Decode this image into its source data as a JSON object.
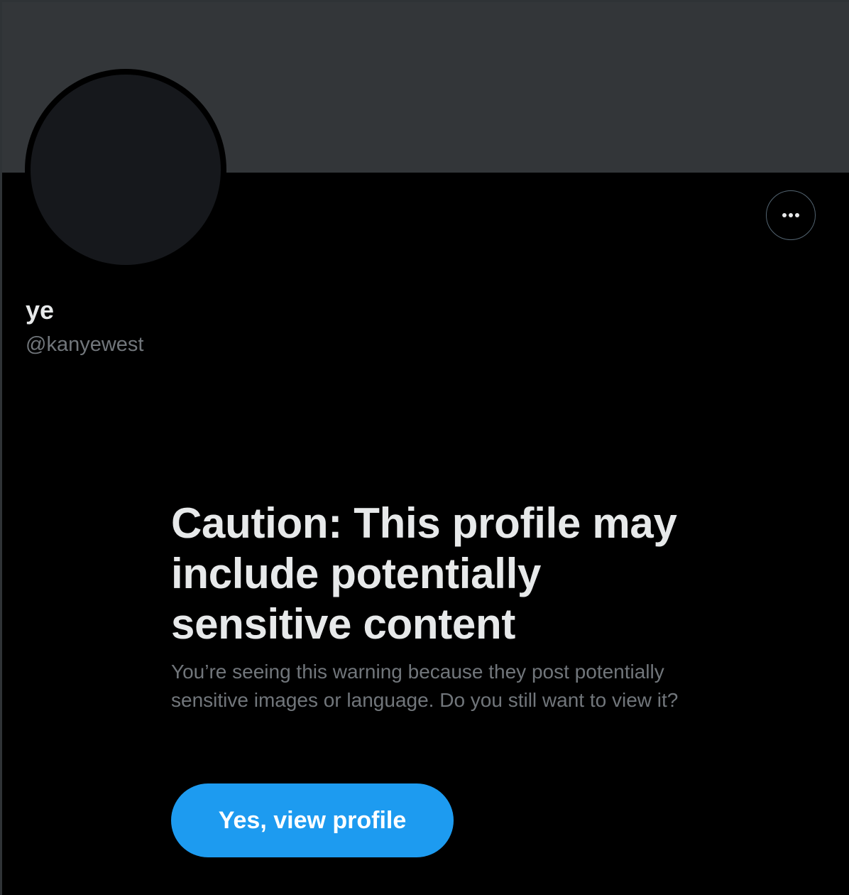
{
  "profile": {
    "display_name": "ye",
    "handle": "@kanyewest"
  },
  "actions": {
    "more_icon": "more-horizontal-icon"
  },
  "warning": {
    "title": "Caution: This profile may include potentially sensitive content",
    "description": "You’re seeing this warning because they post potentially sensitive images or language. Do you still want to view it?",
    "confirm_label": "Yes, view profile"
  },
  "colors": {
    "background": "#000000",
    "banner": "#333639",
    "avatar": "#16181c",
    "primary_text": "#e7e9ea",
    "secondary_text": "#71767b",
    "accent": "#1d9bf0"
  }
}
